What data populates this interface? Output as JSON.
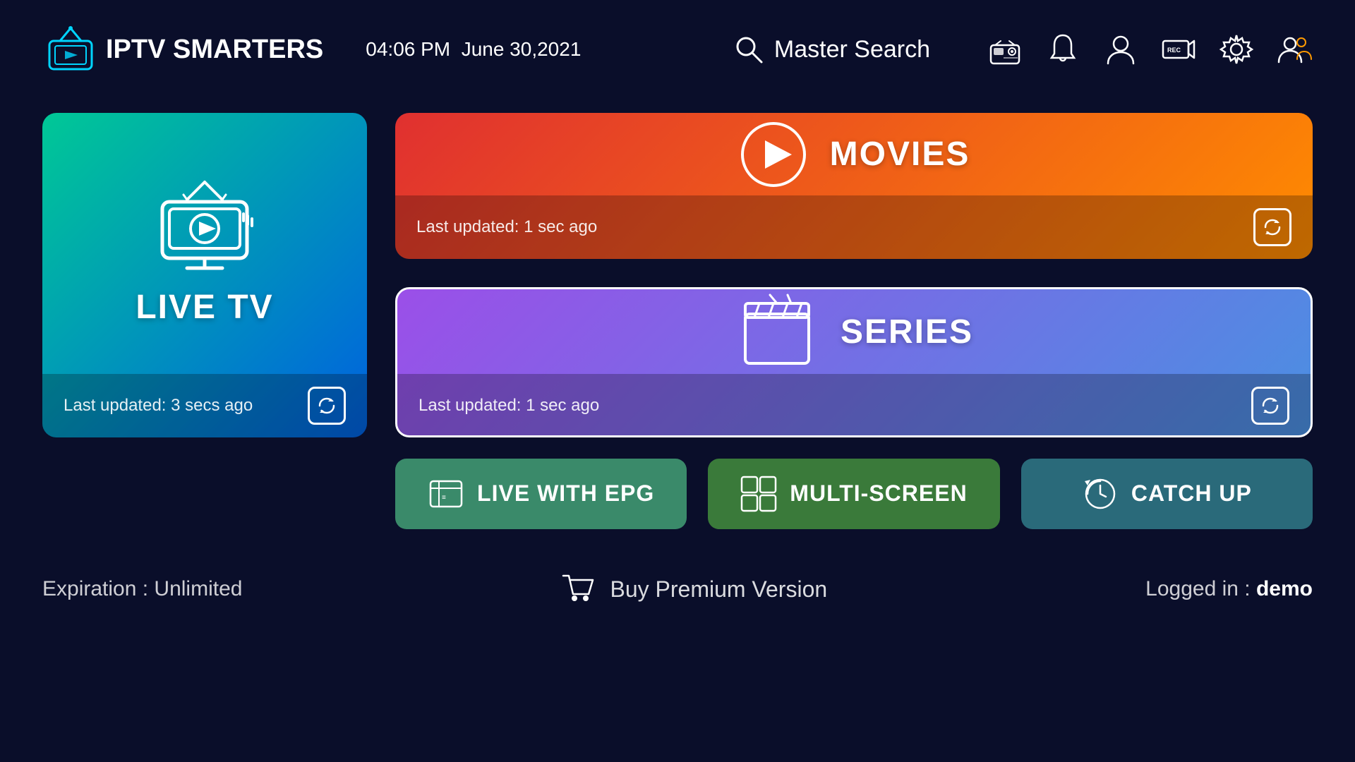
{
  "header": {
    "logo_text_part1": "IPTV",
    "logo_text_part2": "SMARTERS",
    "time": "04:06 PM",
    "date": "June 30,2021",
    "search_label": "Master Search",
    "icons": [
      "radio-icon",
      "bell-icon",
      "user-icon",
      "record-icon",
      "settings-icon",
      "users-icon"
    ]
  },
  "cards": {
    "live_tv": {
      "title": "LIVE TV",
      "footer_text": "Last updated: 3 secs ago"
    },
    "movies": {
      "title": "MOVIES",
      "footer_text": "Last updated: 1 sec ago"
    },
    "series": {
      "title": "SERIES",
      "footer_text": "Last updated: 1 sec ago"
    }
  },
  "actions": {
    "live_epg": "LIVE WITH EPG",
    "multiscreen": "MULTI-SCREEN",
    "catchup": "CATCH UP"
  },
  "footer": {
    "expiration_label": "Expiration :",
    "expiration_value": "Unlimited",
    "buy_premium": "Buy Premium Version",
    "logged_in_label": "Logged in :",
    "logged_in_value": "demo"
  }
}
